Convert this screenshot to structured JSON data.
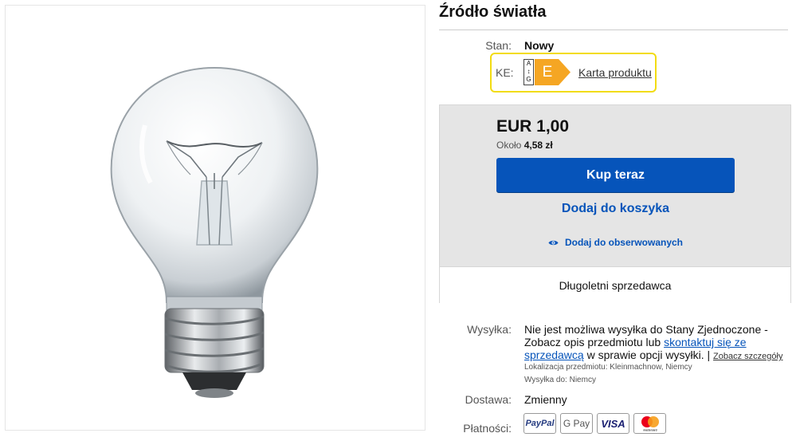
{
  "product": {
    "title": "Źródło światła",
    "condition_label": "Stan:",
    "condition_value": "Nowy"
  },
  "energy": {
    "label": "KE:",
    "class": "E",
    "scale_top": "A",
    "scale_bottom": "G",
    "link_text": "Karta produktu",
    "color": "#f5a623"
  },
  "buy": {
    "price": "EUR 1,00",
    "approx_prefix": "Około",
    "approx_value": "4,58 zł",
    "buy_now": "Kup teraz",
    "add_to_cart": "Dodaj do koszyka",
    "watch": "Dodaj do obserwowanych",
    "seller_status": "Długoletni sprzedawca",
    "accent": "#0654ba"
  },
  "shipping": {
    "label": "Wysyłka:",
    "text_1": "Nie jest możliwa wysyłka do Stany Zjednoczone - Zobacz opis przedmiotu lub",
    "contact_link": "skontaktuj się ze sprzedawcą",
    "text_2": "w sprawie opcji wysyłki. |",
    "details_link": "Zobacz szczegóły",
    "location_label": "Lokalizacja przedmiotu:",
    "location_value": "Kleinmachnow, Niemcy",
    "ships_to_label": "Wysyłka do:",
    "ships_to_value": "Niemcy"
  },
  "delivery": {
    "label": "Dostawa:",
    "value": "Zmienny"
  },
  "payments": {
    "label": "Płatności:",
    "methods": [
      "PayPal",
      "G Pay",
      "VISA",
      "mastercard"
    ]
  }
}
